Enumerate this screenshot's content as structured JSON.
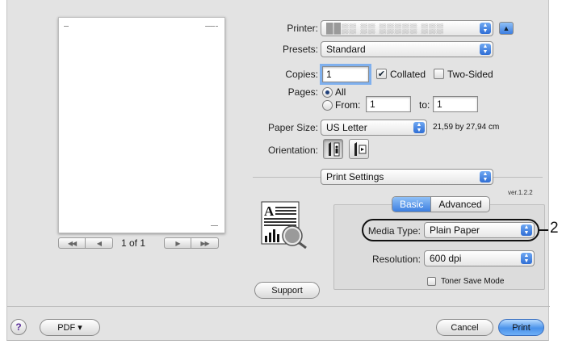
{
  "printer": {
    "label": "Printer:",
    "value": "██▒▒ ▒▒ ▒▒▒▒▒ ▒▒▒"
  },
  "presets": {
    "label": "Presets:",
    "value": "Standard"
  },
  "copies": {
    "label": "Copies:",
    "value": "1",
    "collated_label": "Collated",
    "collated_checked": true,
    "two_sided_label": "Two-Sided",
    "two_sided_checked": false
  },
  "pages": {
    "label": "Pages:",
    "all_label": "All",
    "from_label": "From:",
    "from_value": "1",
    "to_label": "to:",
    "to_value": "1"
  },
  "paper_size": {
    "label": "Paper Size:",
    "value": "US Letter",
    "dimensions": "21,59 by 27,94 cm"
  },
  "orientation": {
    "label": "Orientation:"
  },
  "section": {
    "value": "Print Settings"
  },
  "version": "ver.1.2.2",
  "tabs": {
    "basic": "Basic",
    "advanced": "Advanced"
  },
  "media_type": {
    "label": "Media Type:",
    "value": "Plain Paper"
  },
  "resolution": {
    "label": "Resolution:",
    "value": "600 dpi"
  },
  "toner_save": {
    "label": "Toner Save Mode",
    "checked": false
  },
  "support_button": "Support",
  "preview": {
    "page_count": "1 of 1",
    "first": "◀◀",
    "prev": "◀",
    "next": "▶",
    "last": "▶▶"
  },
  "footer": {
    "help": "?",
    "pdf": "PDF ▾",
    "cancel": "Cancel",
    "print": "Print"
  },
  "callout_number": "2",
  "colors": {
    "accent": "#3d7fe0",
    "panel": "#e3e3e3"
  },
  "icons": [
    "portrait-orientation-icon",
    "landscape-orientation-icon",
    "printer-quality-icon",
    "help-icon",
    "popup-arrows-icon"
  ]
}
